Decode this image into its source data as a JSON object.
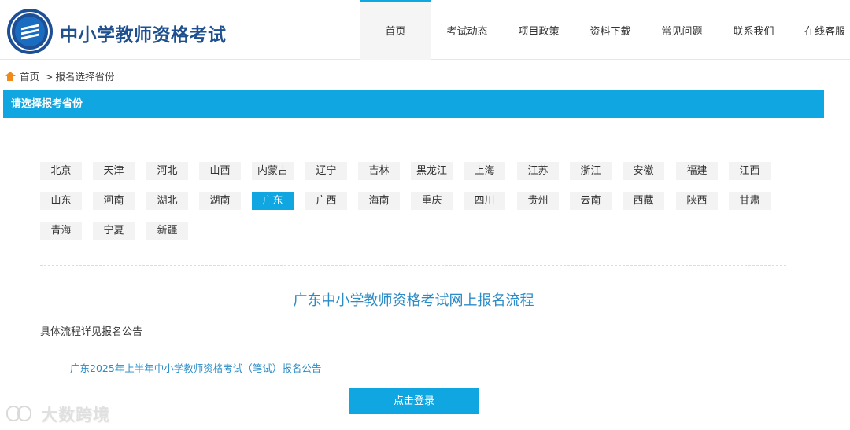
{
  "header": {
    "site_title": "中小学教师资格考试",
    "nav": [
      {
        "label": "首页",
        "active": true
      },
      {
        "label": "考试动态",
        "active": false
      },
      {
        "label": "项目政策",
        "active": false
      },
      {
        "label": "资料下载",
        "active": false
      },
      {
        "label": "常见问题",
        "active": false
      },
      {
        "label": "联系我们",
        "active": false
      },
      {
        "label": "在线客服",
        "active": false
      }
    ]
  },
  "breadcrumb": {
    "home": "首页",
    "separator": ">",
    "current": "报名选择省份"
  },
  "section": {
    "title": "请选择报考省份"
  },
  "provinces": {
    "selected": "广东",
    "items": [
      "北京",
      "天津",
      "河北",
      "山西",
      "内蒙古",
      "辽宁",
      "吉林",
      "黑龙江",
      "上海",
      "江苏",
      "浙江",
      "安徽",
      "福建",
      "江西",
      "山东",
      "河南",
      "湖北",
      "湖南",
      "广东",
      "广西",
      "海南",
      "重庆",
      "四川",
      "贵州",
      "云南",
      "西藏",
      "陕西",
      "甘肃",
      "青海",
      "宁夏",
      "新疆"
    ]
  },
  "flow": {
    "title": "广东中小学教师资格考试网上报名流程",
    "description": "具体流程详见报名公告",
    "notice_link": "广东2025年上半年中小学教师资格考试（笔试）报名公告",
    "login_button": "点击登录"
  },
  "watermark": {
    "text": "大数跨境"
  },
  "colors": {
    "accent": "#0fa6e1",
    "title_blue": "#1e4f8f",
    "link_blue": "#2a8cc7",
    "home_icon": "#f08a18"
  }
}
